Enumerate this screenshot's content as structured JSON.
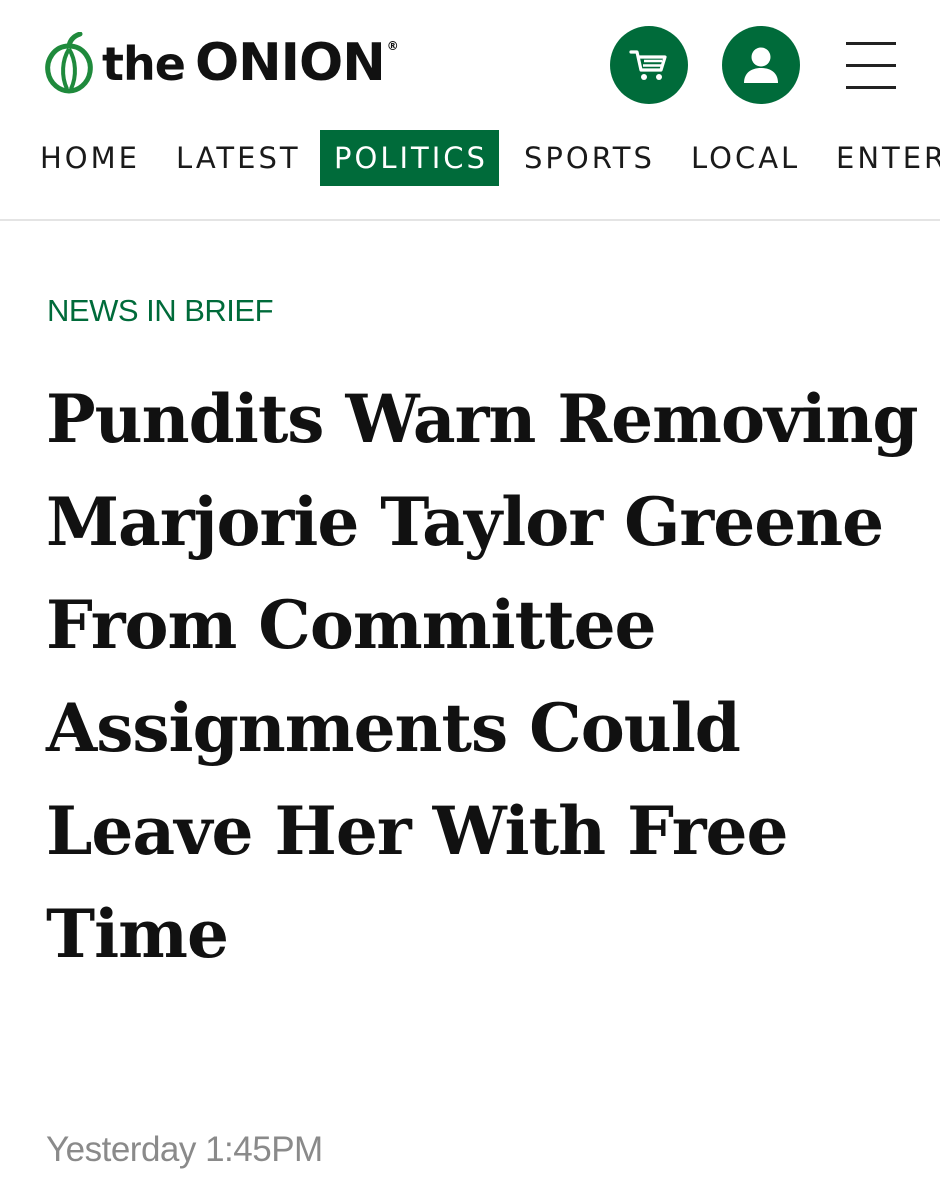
{
  "brand": {
    "logo_prefix": "the",
    "logo_name": "ONION",
    "logo_reg": "®",
    "accent_color": "#006b3a"
  },
  "header": {
    "cart_icon": "shopping-cart-icon",
    "account_icon": "user-icon",
    "menu_icon": "hamburger-menu-icon"
  },
  "nav": {
    "items": [
      {
        "label": "HOME"
      },
      {
        "label": "LATEST"
      },
      {
        "label": "POLITICS",
        "active": true
      },
      {
        "label": "SPORTS"
      },
      {
        "label": "LOCAL"
      },
      {
        "label": "ENTER"
      }
    ]
  },
  "article": {
    "kicker": "NEWS IN BRIEF",
    "headline": "Pundits Warn Removing Marjorie Taylor Greene From Committee Assignments Could Leave Her With Free Time",
    "timestamp": "Yesterday 1:45PM"
  }
}
